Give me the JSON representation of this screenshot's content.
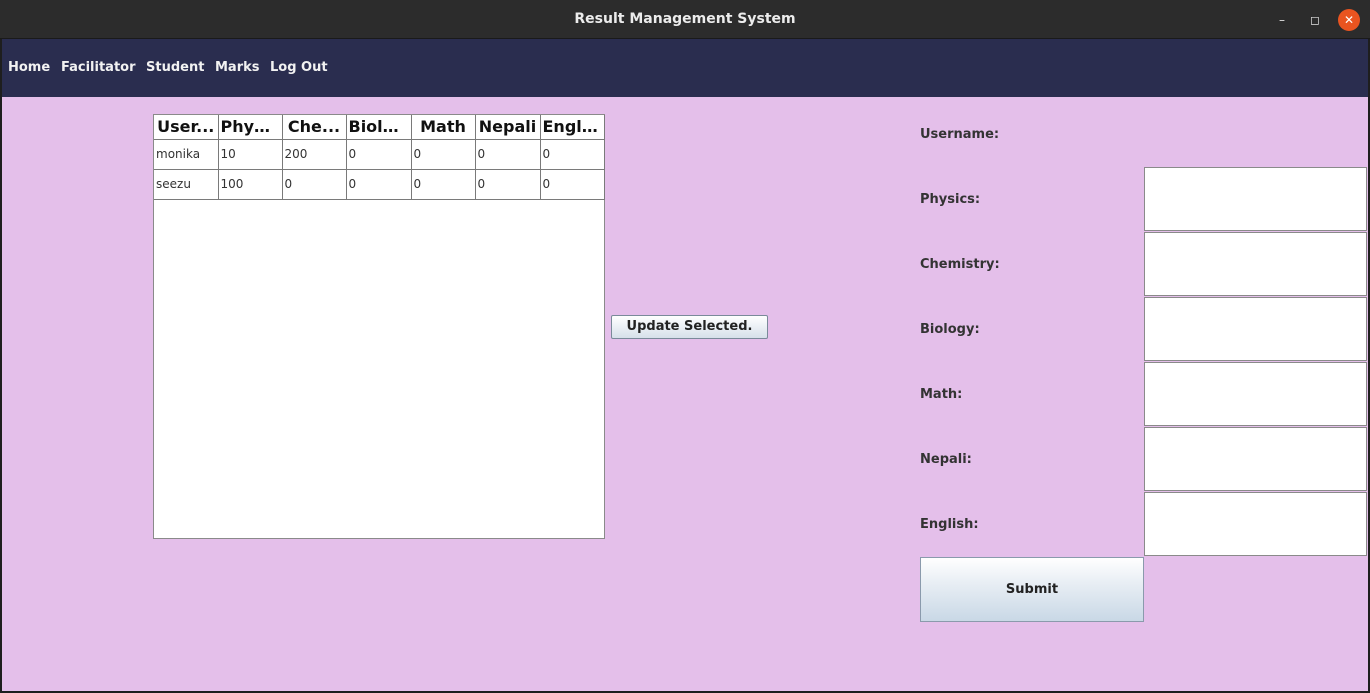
{
  "window": {
    "title": "Result Management System",
    "controls": {
      "minimize": "–",
      "maximize": "◻",
      "close": "✕"
    }
  },
  "menu": [
    "Home",
    "Facilitator",
    "Student",
    "Marks",
    "Log Out"
  ],
  "table": {
    "headers": [
      "User...",
      "Phys...",
      "Che...",
      "Biology",
      "Math",
      "Nepali",
      "English"
    ],
    "rows": [
      [
        "monika",
        "10",
        "200",
        "0",
        "0",
        "0",
        "0"
      ],
      [
        "seezu",
        "100",
        "0",
        "0",
        "0",
        "0",
        "0"
      ]
    ]
  },
  "update_button": "Update Selected.",
  "form": {
    "username_label": "Username:",
    "fields": [
      {
        "label": "Physics:",
        "value": ""
      },
      {
        "label": "Chemistry:",
        "value": ""
      },
      {
        "label": "Biology:",
        "value": ""
      },
      {
        "label": "Math:",
        "value": ""
      },
      {
        "label": "Nepali:",
        "value": ""
      },
      {
        "label": "English:",
        "value": ""
      }
    ],
    "submit_label": "Submit"
  },
  "colors": {
    "menubar": "#2a2d4f",
    "content_bg": "#e4bfea",
    "close_button": "#e95420"
  }
}
